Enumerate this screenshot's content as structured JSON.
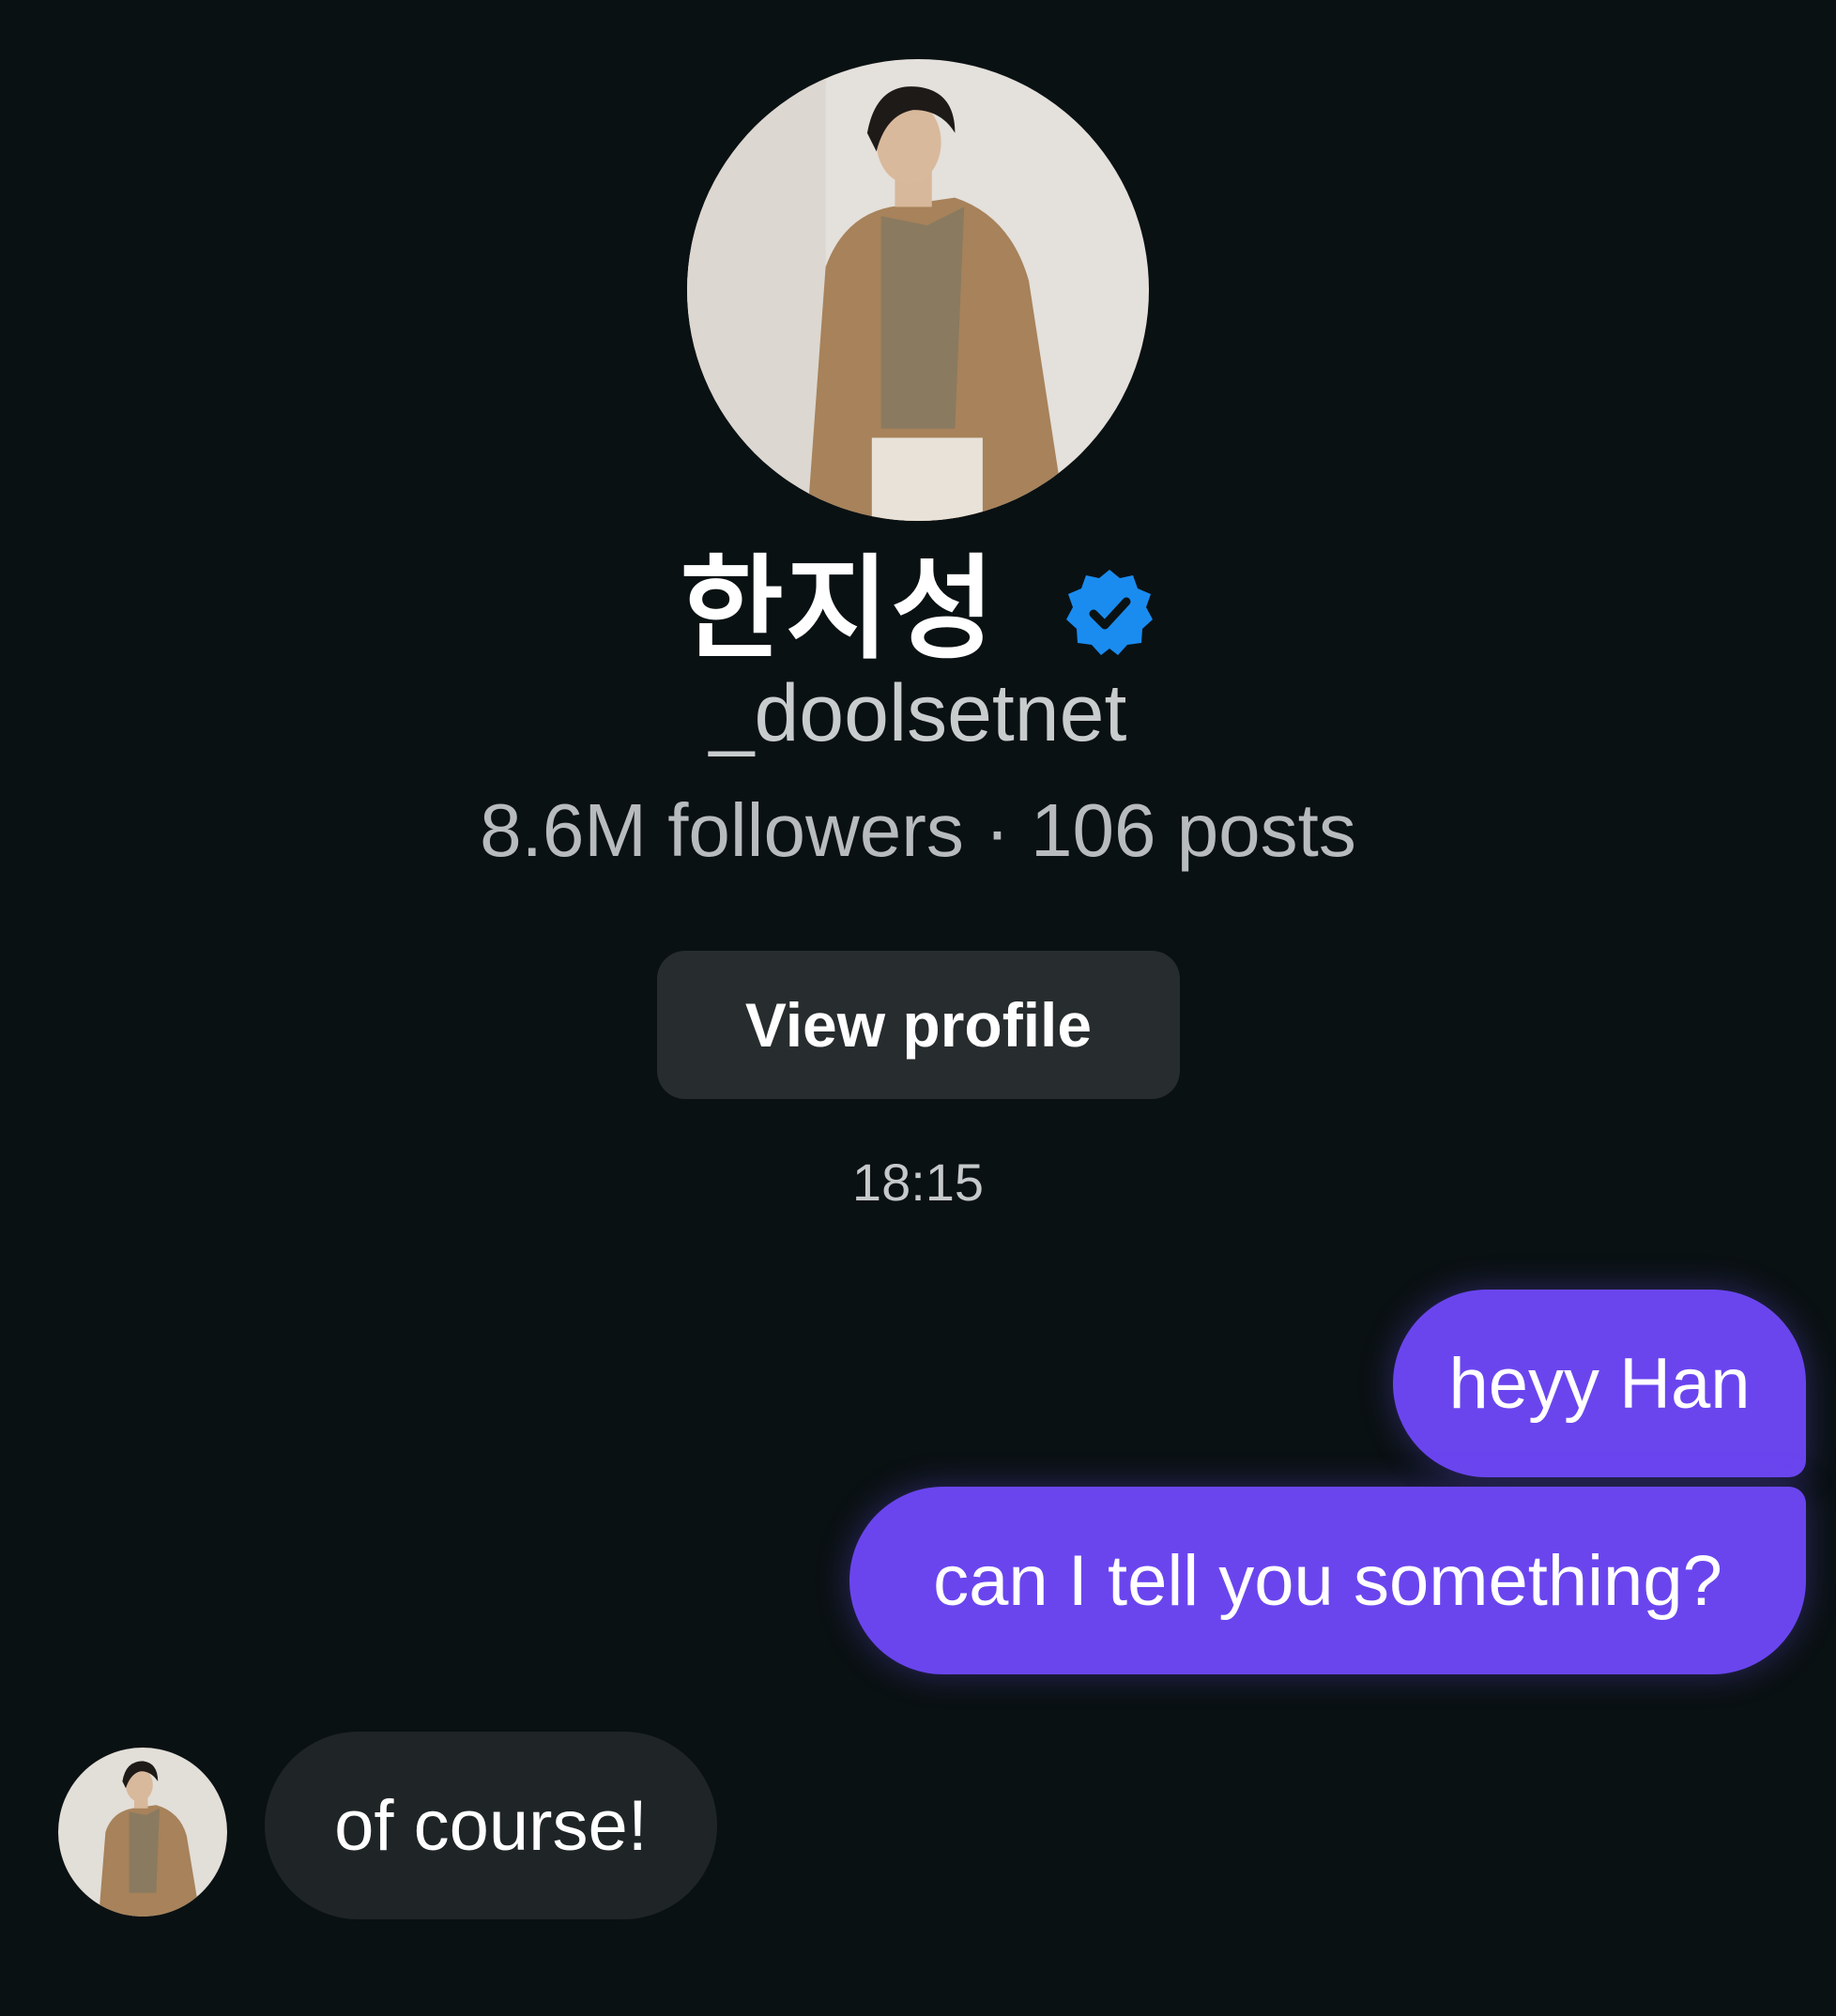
{
  "profile": {
    "avatar_icon": "profile-photo",
    "display_name": "한지성",
    "verified_icon": "verified-badge-icon",
    "username": "_doolsetnet",
    "followers_value": "8.6M",
    "followers_label": "followers",
    "separator": "·",
    "posts_value": "106",
    "posts_label": "posts",
    "view_profile_label": "View profile"
  },
  "thread": {
    "timestamp": "18:15",
    "messages": [
      {
        "direction": "outgoing",
        "text": "heyy Han"
      },
      {
        "direction": "outgoing",
        "text": "can I tell you something?"
      },
      {
        "direction": "incoming",
        "text": "of course!"
      }
    ]
  },
  "colors": {
    "background": "#0a1113",
    "outgoing_bubble": "#6a45ee",
    "incoming_bubble": "#1f2527",
    "button": "#272c2e",
    "verified": "#1a8cf0"
  }
}
